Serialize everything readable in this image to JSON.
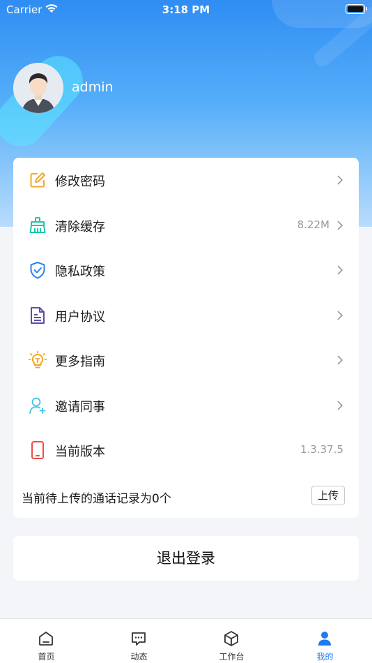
{
  "status_bar": {
    "carrier": "Carrier",
    "time": "3:18 PM"
  },
  "profile": {
    "username": "admin"
  },
  "menu": {
    "items": [
      {
        "label": "修改密码",
        "value": "",
        "icon": "edit-icon",
        "color": "#f5a623"
      },
      {
        "label": "清除缓存",
        "value": "8.22M",
        "icon": "broom-icon",
        "color": "#1fc7a8"
      },
      {
        "label": "隐私政策",
        "value": "",
        "icon": "shield-check-icon",
        "color": "#2b83f0"
      },
      {
        "label": "用户协议",
        "value": "",
        "icon": "document-icon",
        "color": "#5b4fa8"
      },
      {
        "label": "更多指南",
        "value": "",
        "icon": "lightbulb-icon",
        "color": "#f5a623"
      },
      {
        "label": "邀请同事",
        "value": "",
        "icon": "user-add-icon",
        "color": "#3cc4e8"
      },
      {
        "label": "当前版本",
        "value": "1.3.37.5",
        "icon": "phone-icon",
        "color": "#f04b4b"
      }
    ],
    "upload_text": "当前待上传的通话记录为0个",
    "upload_button": "上传"
  },
  "logout_label": "退出登录",
  "tabbar": {
    "tabs": [
      {
        "label": "首页",
        "icon": "home-icon",
        "active": false
      },
      {
        "label": "动态",
        "icon": "message-icon",
        "active": false
      },
      {
        "label": "工作台",
        "icon": "cube-icon",
        "active": false
      },
      {
        "label": "我的",
        "icon": "person-icon",
        "active": true
      }
    ],
    "active_color": "#1e7cf0"
  }
}
